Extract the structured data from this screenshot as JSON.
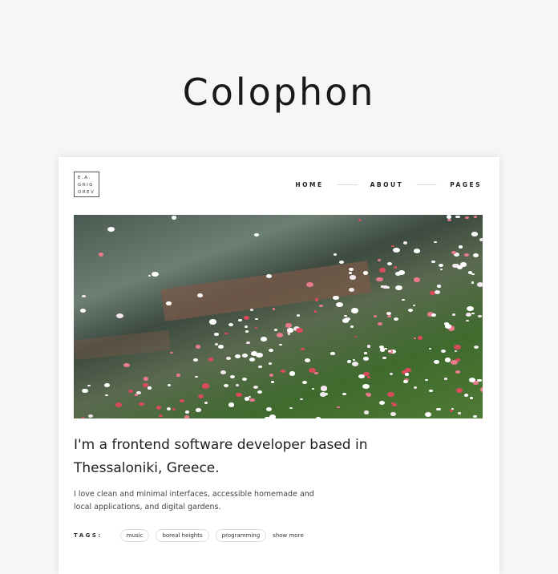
{
  "page_title": "Colophon",
  "logo": {
    "lines": [
      "E.A.",
      "GRIG",
      "OREV"
    ]
  },
  "nav": {
    "items": [
      "HOME",
      "ABOUT",
      "PAGES"
    ]
  },
  "hero_image": {
    "alt": "flowers"
  },
  "headline": "I'm a frontend software developer based in Thessaloniki, Greece.",
  "description": "I love clean and minimal interfaces, accessible homemade and local applications, and digital gardens.",
  "tags": {
    "label": "TAGS:",
    "items": [
      "music",
      "boreal heights",
      "programming"
    ],
    "show_more": "show more"
  }
}
